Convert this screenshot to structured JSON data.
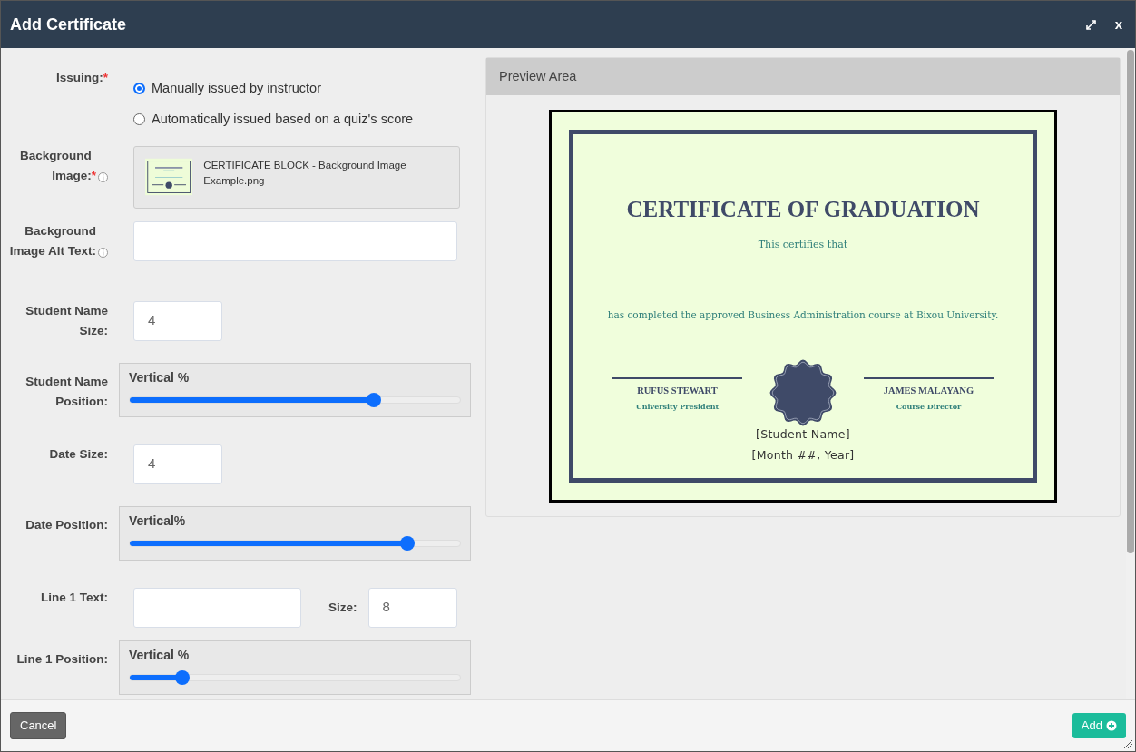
{
  "window": {
    "title": "Add Certificate",
    "close_label": "x"
  },
  "form": [
    {
      "kind": "radio",
      "label": "Issuing:",
      "required_mark": "*",
      "options": [
        {
          "label": "Manually issued by instructor",
          "selected": true
        },
        {
          "label": "Automatically issued based on a quiz's score",
          "selected": false
        }
      ]
    },
    {
      "kind": "file",
      "label": "Background Image:",
      "required_mark": "*",
      "info": true,
      "file_name": "CERTIFICATE BLOCK - Background Image Example.png"
    },
    {
      "kind": "text",
      "label": "Background Image Alt Text:",
      "info": true
    },
    {
      "kind": "number",
      "label": "Student Name Size:",
      "value": "4"
    },
    {
      "kind": "slider",
      "label": "Student Name Position:",
      "caption": "Vertical %",
      "level": 0.74
    },
    {
      "kind": "number",
      "label": "Date Size:",
      "value": "4"
    },
    {
      "kind": "slider",
      "label": "Date Position:",
      "caption": "Vertical%",
      "level": 0.84
    },
    {
      "kind": "text_size",
      "label": "Line 1 Text:",
      "size_label": "Size:",
      "size_value": "8"
    },
    {
      "kind": "slider",
      "label": "Line 1 Position:",
      "caption": "Vertical %",
      "level": 0.16
    }
  ],
  "preview": {
    "title": "Preview Area",
    "certificate": {
      "heading": "CERTIFICATE OF GRADUATION",
      "intro": "This certifies that",
      "body": "has completed the approved Business Administration course at Bixou University.",
      "signers": [
        {
          "name": "RUFUS STEWART",
          "role": "University President"
        },
        {
          "name": "JAMES MALAYANG",
          "role": "Course Director"
        }
      ],
      "student_name": "[Student Name]",
      "date": "[Month ##, Year]"
    }
  },
  "footer": {
    "cancel": "Cancel",
    "add": "Add"
  }
}
